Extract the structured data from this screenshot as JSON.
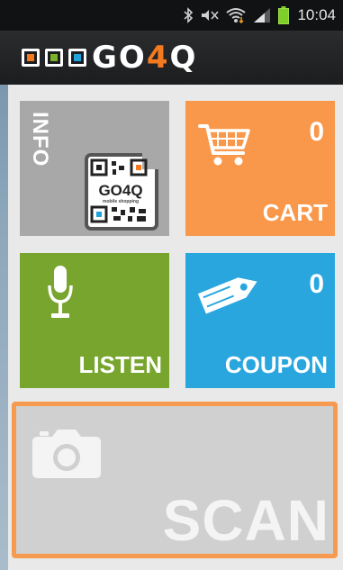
{
  "status_bar": {
    "time": "10:04",
    "icons": [
      "bluetooth-icon",
      "mute-icon",
      "wifi-icon",
      "signal-icon",
      "battery-icon"
    ]
  },
  "header": {
    "logo_prefix": "GO",
    "logo_accent": "4",
    "logo_suffix": "Q",
    "square_colors": [
      "#f47a20",
      "#7ab229",
      "#1ea3dc"
    ]
  },
  "tiles": {
    "info": {
      "label": "INFO",
      "color": "#a8a8a8",
      "qr_caption": "GO4Q",
      "qr_subcaption": "mobile shopping"
    },
    "cart": {
      "label": "CART",
      "count": "0",
      "color": "#f9984b"
    },
    "listen": {
      "label": "LISTEN",
      "color": "#77a52e"
    },
    "coupon": {
      "label": "COUPON",
      "count": "0",
      "color": "#2aa6df"
    },
    "scan": {
      "label": "SCAN",
      "color": "#d0d0d0",
      "border_color": "#f59a4e"
    }
  }
}
